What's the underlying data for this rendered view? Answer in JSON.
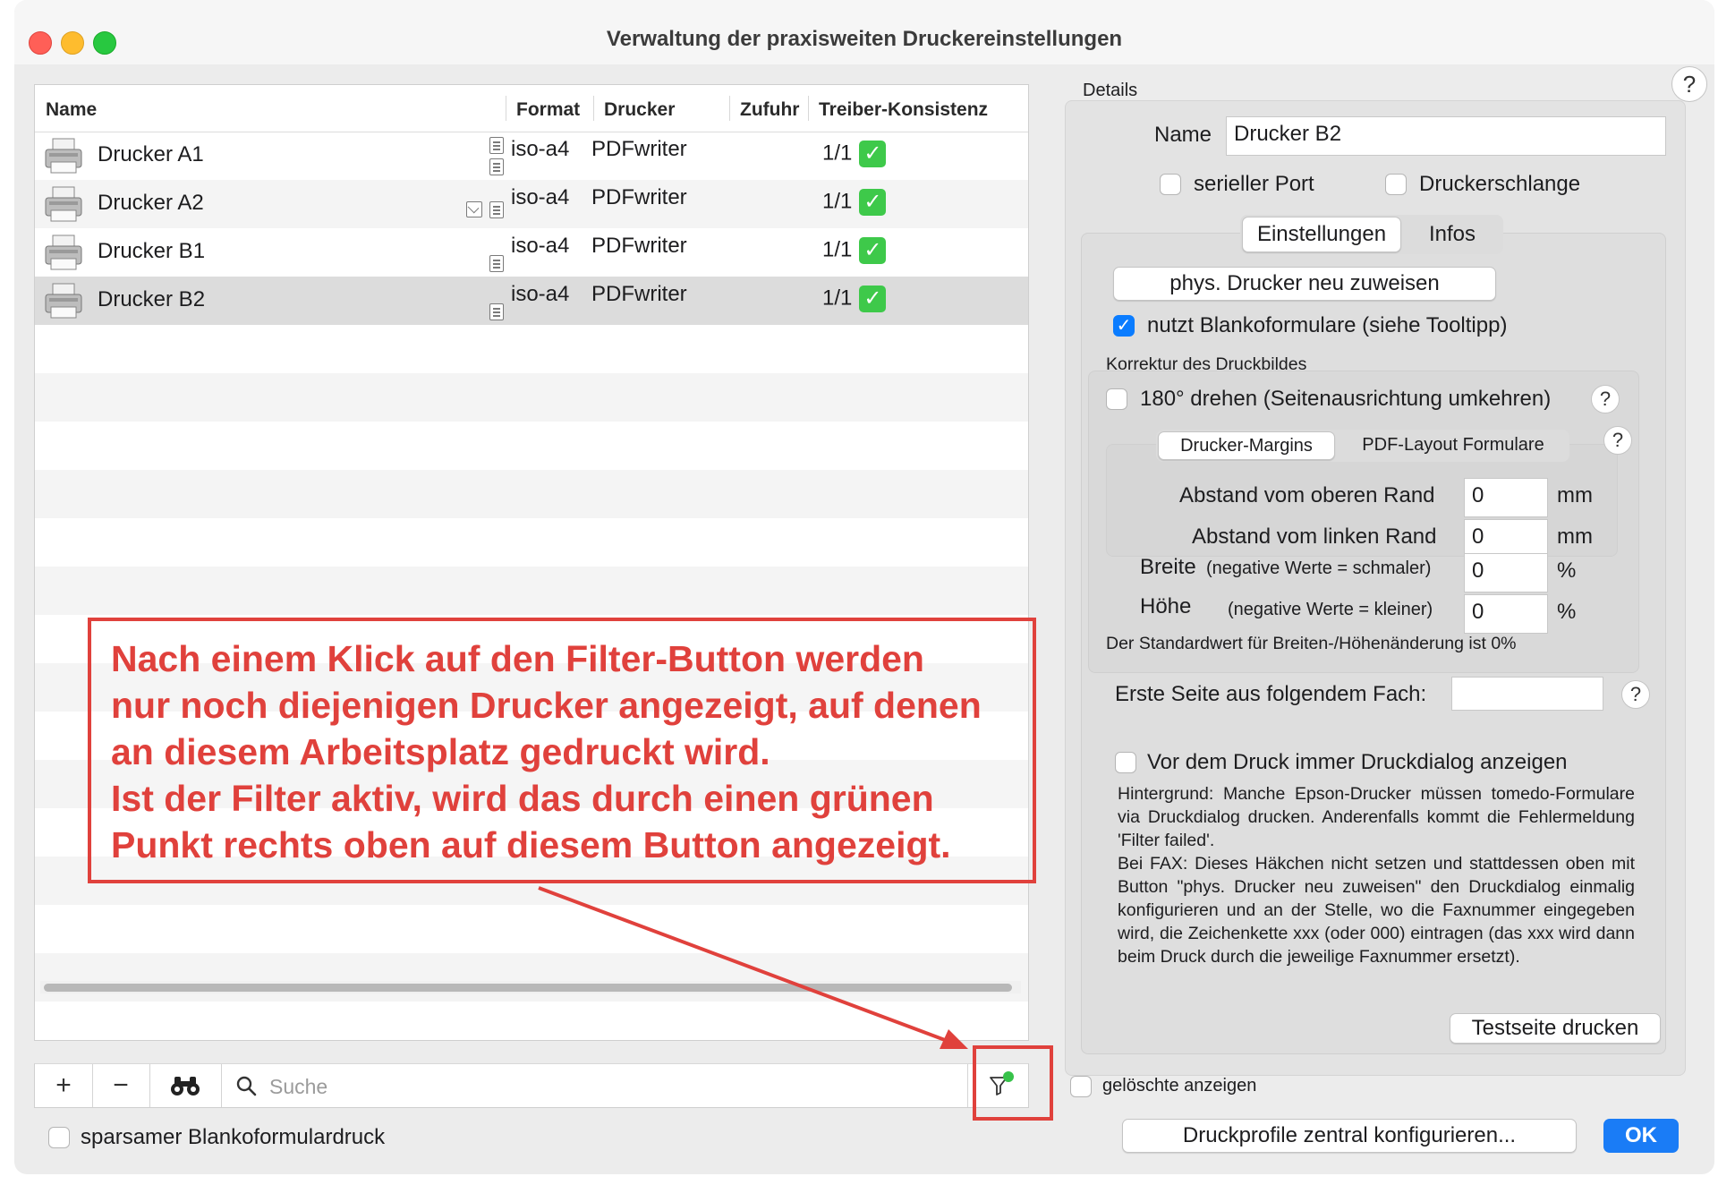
{
  "window": {
    "title": "Verwaltung der praxisweiten Druckereinstellungen"
  },
  "table": {
    "columns": [
      "Name",
      "Format",
      "Drucker",
      "Zufuhr",
      "Treiber-Konsistenz"
    ],
    "rows": [
      {
        "name": "Drucker A1",
        "format": "iso-a4",
        "drucker": "PDFwriter",
        "zufuhr": "",
        "konsistenz": "1/1"
      },
      {
        "name": "Drucker A2",
        "format": "iso-a4",
        "drucker": "PDFwriter",
        "zufuhr": "",
        "konsistenz": "1/1"
      },
      {
        "name": "Drucker B1",
        "format": "iso-a4",
        "drucker": "PDFwriter",
        "zufuhr": "",
        "konsistenz": "1/1"
      },
      {
        "name": "Drucker B2",
        "format": "iso-a4",
        "drucker": "PDFwriter",
        "zufuhr": "",
        "konsistenz": "1/1"
      }
    ],
    "selected_row": "Drucker B2"
  },
  "toolbar": {
    "add_label": "+",
    "remove_label": "−",
    "search_placeholder": "Suche",
    "filter_active": true
  },
  "bottom_left": {
    "sparsam_label": "sparsamer Blankoformulardruck"
  },
  "details": {
    "section_label": "Details",
    "help_label": "?",
    "name_label": "Name",
    "name_value": "Drucker B2",
    "seriell_label": "serieller Port",
    "schlange_label": "Druckerschlange",
    "tabs": [
      "Einstellungen",
      "Infos"
    ],
    "reassign_label": "phys. Drucker neu zuweisen",
    "blanko_label": "nutzt Blankoformulare (siehe Tooltipp)",
    "korrektur_label": "Korrektur des Druckbildes",
    "rotate_label": "180° drehen (Seitenausrichtung umkehren)",
    "subtabs": [
      "Drucker-Margins",
      "PDF-Layout Formulare"
    ],
    "oben_label": "Abstand vom oberen Rand",
    "oben_value": "0",
    "oben_unit": "mm",
    "links_label": "Abstand vom linken Rand",
    "links_value": "0",
    "links_unit": "mm",
    "breite_label": "Breite",
    "breite_hint": "(negative Werte = schmaler)",
    "breite_value": "0",
    "breite_unit": "%",
    "hoehe_label": "Höhe",
    "hoehe_hint": "(negative Werte = kleiner)",
    "hoehe_value": "0",
    "hoehe_unit": "%",
    "standard_note": "Der Standardwert für Breiten-/Höhenänderung ist 0%",
    "erste_seite_label": "Erste Seite aus folgendem Fach:",
    "erste_seite_value": "",
    "dialog_label": "Vor dem Druck immer Druckdialog anzeigen",
    "description": "Hintergrund: Manche Epson-Drucker müssen tomedo-Formulare via Druckdialog drucken. Anderenfalls kommt die Fehlermeldung 'Filter failed'.\nBei FAX: Dieses Häkchen nicht setzen und stattdessen oben mit Button \"phys. Drucker neu zuweisen\" den Druckdialog einmalig konfigurieren und an der Stelle, wo die Faxnummer eingegeben wird, die Zeichenkette xxx (oder 000) eintragen (das xxx wird dann beim Druck durch die jeweilige Faxnummer ersetzt).",
    "testseite_label": "Testseite drucken",
    "geloeschte_label": "gelöschte anzeigen"
  },
  "footer": {
    "profile_label": "Druckprofile zentral konfigurieren...",
    "ok_label": "OK"
  },
  "annotation": {
    "lines": [
      "Nach einem Klick auf den Filter-Button werden",
      "nur noch diejenigen Drucker angezeigt, auf denen",
      "an diesem Arbeitsplatz gedruckt wird.",
      "Ist der Filter aktiv, wird das durch einen grünen",
      "Punkt rechts oben auf diesem Button angezeigt."
    ]
  },
  "colors": {
    "accent": "#1a7cf6",
    "annotation": "#e0413c",
    "status_ok": "#3ec94a"
  }
}
